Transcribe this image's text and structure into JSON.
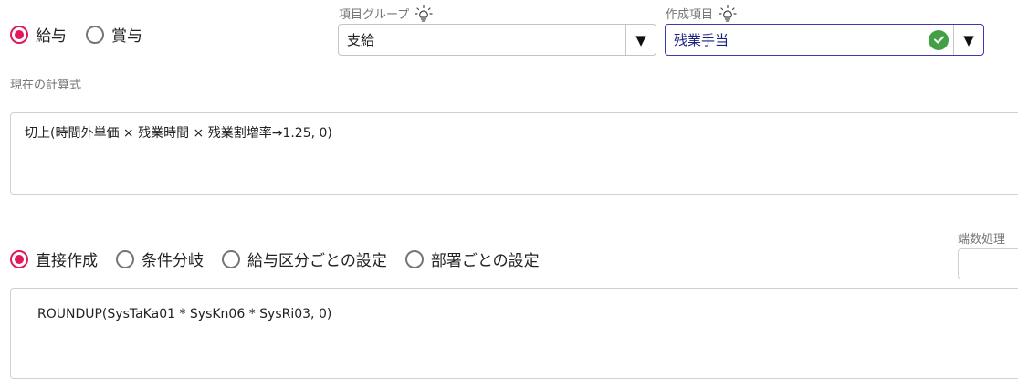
{
  "pay_type": {
    "options": [
      {
        "label": "給与",
        "checked": true
      },
      {
        "label": "賞与",
        "checked": false
      }
    ]
  },
  "item_group": {
    "label": "項目グループ",
    "value": "支給",
    "hint_icon": "lightbulb-icon"
  },
  "created_item": {
    "label": "作成項目",
    "value": "残業手当",
    "hint_icon": "lightbulb-icon",
    "status_icon": "check-circle-icon"
  },
  "current_formula": {
    "label": "現在の計算式",
    "text": "切上(時間外単価 × 残業時間 × 残業割増率→1.25, 0)"
  },
  "mode": {
    "options": [
      {
        "label": "直接作成",
        "checked": true
      },
      {
        "label": "条件分岐",
        "checked": false
      },
      {
        "label": "給与区分ごとの設定",
        "checked": false
      },
      {
        "label": "部署ごとの設定",
        "checked": false
      }
    ]
  },
  "rounding": {
    "label": "端数処理",
    "value": ""
  },
  "formula_editor": {
    "text": "ROUNDUP(SysTaKa01 * SysKn06 * SysRi03, 0)"
  },
  "colors": {
    "accent": "#e0195b",
    "active_border": "#3a3aa8",
    "success": "#43a047"
  }
}
